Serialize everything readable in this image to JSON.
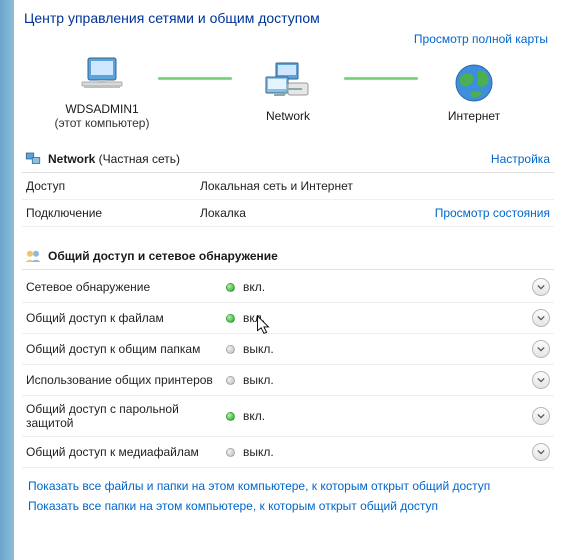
{
  "title": "Центр управления сетями и общим доступом",
  "map_link": "Просмотр полной карты",
  "map": {
    "node1": {
      "label": "WDSADMIN1",
      "sub": "(этот компьютер)"
    },
    "node2": {
      "label": "Network"
    },
    "node3": {
      "label": "Интернет"
    }
  },
  "network": {
    "title_bold": "Network",
    "title_plain": " (Частная сеть)",
    "action": "Настройка",
    "rows": [
      {
        "label": "Доступ",
        "value": "Локальная сеть и Интернет",
        "link": ""
      },
      {
        "label": "Подключение",
        "value": "Локалка",
        "link": "Просмотр состояния"
      }
    ]
  },
  "sharing": {
    "title": "Общий доступ и сетевое обнаружение",
    "items": [
      {
        "label": "Сетевое обнаружение",
        "state": "вкл.",
        "on": true
      },
      {
        "label": "Общий доступ к файлам",
        "state": "вкл.",
        "on": true
      },
      {
        "label": "Общий доступ к общим папкам",
        "state": "выкл.",
        "on": false
      },
      {
        "label": "Использование общих принтеров",
        "state": "выкл.",
        "on": false
      },
      {
        "label": "Общий доступ с парольной защитой",
        "state": "вкл.",
        "on": true
      },
      {
        "label": "Общий доступ к медиафайлам",
        "state": "выкл.",
        "on": false
      }
    ]
  },
  "footer": {
    "link1": "Показать все файлы и папки на этом компьютере, к которым открыт общий доступ",
    "link2": "Показать все папки на этом компьютере, к которым открыт общий доступ"
  }
}
